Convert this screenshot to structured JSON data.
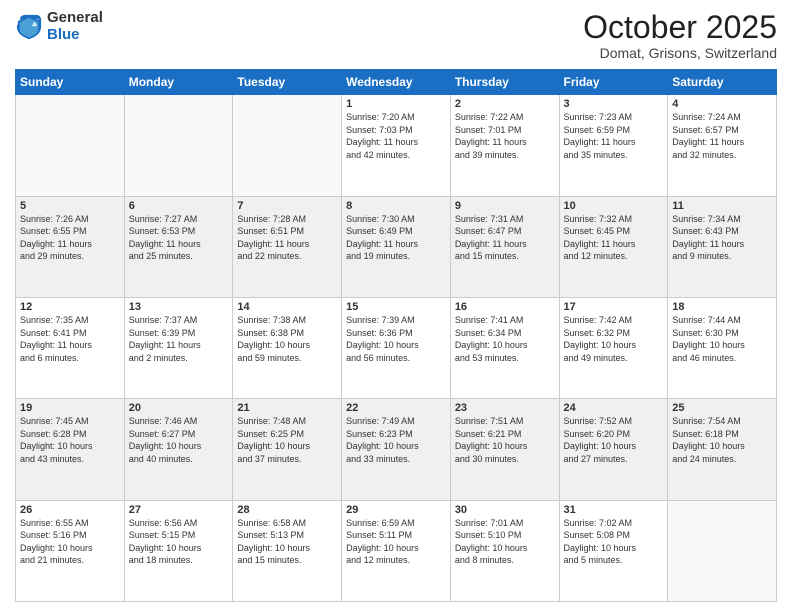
{
  "logo": {
    "general": "General",
    "blue": "Blue"
  },
  "header": {
    "month": "October 2025",
    "location": "Domat, Grisons, Switzerland"
  },
  "weekdays": [
    "Sunday",
    "Monday",
    "Tuesday",
    "Wednesday",
    "Thursday",
    "Friday",
    "Saturday"
  ],
  "weeks": [
    [
      {
        "day": "",
        "info": ""
      },
      {
        "day": "",
        "info": ""
      },
      {
        "day": "",
        "info": ""
      },
      {
        "day": "1",
        "info": "Sunrise: 7:20 AM\nSunset: 7:03 PM\nDaylight: 11 hours\nand 42 minutes."
      },
      {
        "day": "2",
        "info": "Sunrise: 7:22 AM\nSunset: 7:01 PM\nDaylight: 11 hours\nand 39 minutes."
      },
      {
        "day": "3",
        "info": "Sunrise: 7:23 AM\nSunset: 6:59 PM\nDaylight: 11 hours\nand 35 minutes."
      },
      {
        "day": "4",
        "info": "Sunrise: 7:24 AM\nSunset: 6:57 PM\nDaylight: 11 hours\nand 32 minutes."
      }
    ],
    [
      {
        "day": "5",
        "info": "Sunrise: 7:26 AM\nSunset: 6:55 PM\nDaylight: 11 hours\nand 29 minutes."
      },
      {
        "day": "6",
        "info": "Sunrise: 7:27 AM\nSunset: 6:53 PM\nDaylight: 11 hours\nand 25 minutes."
      },
      {
        "day": "7",
        "info": "Sunrise: 7:28 AM\nSunset: 6:51 PM\nDaylight: 11 hours\nand 22 minutes."
      },
      {
        "day": "8",
        "info": "Sunrise: 7:30 AM\nSunset: 6:49 PM\nDaylight: 11 hours\nand 19 minutes."
      },
      {
        "day": "9",
        "info": "Sunrise: 7:31 AM\nSunset: 6:47 PM\nDaylight: 11 hours\nand 15 minutes."
      },
      {
        "day": "10",
        "info": "Sunrise: 7:32 AM\nSunset: 6:45 PM\nDaylight: 11 hours\nand 12 minutes."
      },
      {
        "day": "11",
        "info": "Sunrise: 7:34 AM\nSunset: 6:43 PM\nDaylight: 11 hours\nand 9 minutes."
      }
    ],
    [
      {
        "day": "12",
        "info": "Sunrise: 7:35 AM\nSunset: 6:41 PM\nDaylight: 11 hours\nand 6 minutes."
      },
      {
        "day": "13",
        "info": "Sunrise: 7:37 AM\nSunset: 6:39 PM\nDaylight: 11 hours\nand 2 minutes."
      },
      {
        "day": "14",
        "info": "Sunrise: 7:38 AM\nSunset: 6:38 PM\nDaylight: 10 hours\nand 59 minutes."
      },
      {
        "day": "15",
        "info": "Sunrise: 7:39 AM\nSunset: 6:36 PM\nDaylight: 10 hours\nand 56 minutes."
      },
      {
        "day": "16",
        "info": "Sunrise: 7:41 AM\nSunset: 6:34 PM\nDaylight: 10 hours\nand 53 minutes."
      },
      {
        "day": "17",
        "info": "Sunrise: 7:42 AM\nSunset: 6:32 PM\nDaylight: 10 hours\nand 49 minutes."
      },
      {
        "day": "18",
        "info": "Sunrise: 7:44 AM\nSunset: 6:30 PM\nDaylight: 10 hours\nand 46 minutes."
      }
    ],
    [
      {
        "day": "19",
        "info": "Sunrise: 7:45 AM\nSunset: 6:28 PM\nDaylight: 10 hours\nand 43 minutes."
      },
      {
        "day": "20",
        "info": "Sunrise: 7:46 AM\nSunset: 6:27 PM\nDaylight: 10 hours\nand 40 minutes."
      },
      {
        "day": "21",
        "info": "Sunrise: 7:48 AM\nSunset: 6:25 PM\nDaylight: 10 hours\nand 37 minutes."
      },
      {
        "day": "22",
        "info": "Sunrise: 7:49 AM\nSunset: 6:23 PM\nDaylight: 10 hours\nand 33 minutes."
      },
      {
        "day": "23",
        "info": "Sunrise: 7:51 AM\nSunset: 6:21 PM\nDaylight: 10 hours\nand 30 minutes."
      },
      {
        "day": "24",
        "info": "Sunrise: 7:52 AM\nSunset: 6:20 PM\nDaylight: 10 hours\nand 27 minutes."
      },
      {
        "day": "25",
        "info": "Sunrise: 7:54 AM\nSunset: 6:18 PM\nDaylight: 10 hours\nand 24 minutes."
      }
    ],
    [
      {
        "day": "26",
        "info": "Sunrise: 6:55 AM\nSunset: 5:16 PM\nDaylight: 10 hours\nand 21 minutes."
      },
      {
        "day": "27",
        "info": "Sunrise: 6:56 AM\nSunset: 5:15 PM\nDaylight: 10 hours\nand 18 minutes."
      },
      {
        "day": "28",
        "info": "Sunrise: 6:58 AM\nSunset: 5:13 PM\nDaylight: 10 hours\nand 15 minutes."
      },
      {
        "day": "29",
        "info": "Sunrise: 6:59 AM\nSunset: 5:11 PM\nDaylight: 10 hours\nand 12 minutes."
      },
      {
        "day": "30",
        "info": "Sunrise: 7:01 AM\nSunset: 5:10 PM\nDaylight: 10 hours\nand 8 minutes."
      },
      {
        "day": "31",
        "info": "Sunrise: 7:02 AM\nSunset: 5:08 PM\nDaylight: 10 hours\nand 5 minutes."
      },
      {
        "day": "",
        "info": ""
      }
    ]
  ]
}
